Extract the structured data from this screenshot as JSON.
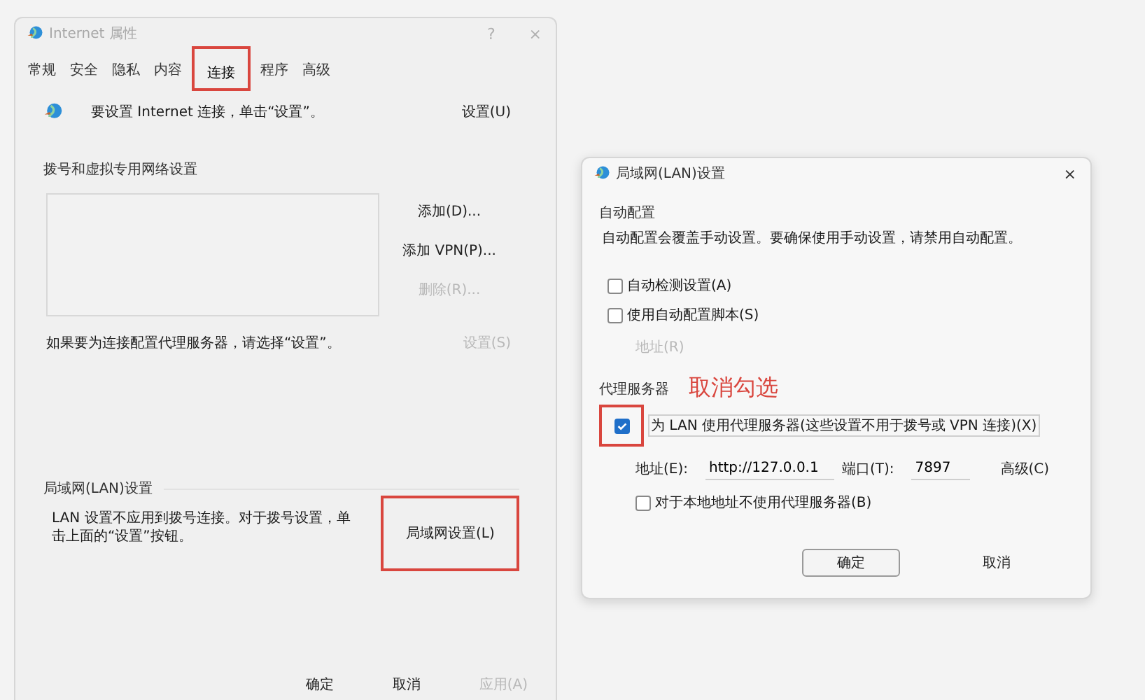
{
  "main_window": {
    "title": "Internet 属性",
    "help": "?",
    "close": "×",
    "tabs": [
      {
        "label": "常规",
        "selected": false,
        "highlighted": false
      },
      {
        "label": "安全",
        "selected": false,
        "highlighted": false
      },
      {
        "label": "隐私",
        "selected": false,
        "highlighted": false
      },
      {
        "label": "内容",
        "selected": false,
        "highlighted": false
      },
      {
        "label": "连接",
        "selected": true,
        "highlighted": true
      },
      {
        "label": "程序",
        "selected": false,
        "highlighted": false
      },
      {
        "label": "高级",
        "selected": false,
        "highlighted": false
      }
    ],
    "setup": {
      "text": "要设置 Internet 连接，单击“设置”。",
      "button": "设置(U)"
    },
    "dialup": {
      "heading": "拨号和虚拟专用网络设置",
      "buttons": [
        {
          "label": "添加(D)...",
          "disabled": false
        },
        {
          "label": "添加 VPN(P)...",
          "disabled": false
        },
        {
          "label": "删除(R)...",
          "disabled": true
        }
      ],
      "hint": "如果要为连接配置代理服务器，请选择“设置”。",
      "settings_button": {
        "label": "设置(S)",
        "disabled": true
      }
    },
    "lan": {
      "heading": "局域网(LAN)设置",
      "text": "LAN 设置不应用到拨号连接。对于拨号设置，单击上面的“设置”按钮。",
      "button": {
        "label": "局域网设置(L)",
        "highlighted": true
      }
    },
    "footer": [
      {
        "label": "确定",
        "disabled": false
      },
      {
        "label": "取消",
        "disabled": false
      },
      {
        "label": "应用(A)",
        "disabled": true
      }
    ]
  },
  "lan_dialog": {
    "title": "局域网(LAN)设置",
    "close": "×",
    "auto_config": {
      "heading": "自动配置",
      "text": "自动配置会覆盖手动设置。要确保使用手动设置，请禁用自动配置。",
      "checkboxes": [
        {
          "label": "自动检测设置(A)",
          "checked": false
        },
        {
          "label": "使用自动配置脚本(S)",
          "checked": false
        }
      ],
      "address_label": {
        "label": "地址(R)",
        "disabled": true
      }
    },
    "proxy": {
      "heading": "代理服务器",
      "use_proxy": {
        "label": "为 LAN 使用代理服务器(这些设置不用于拨号或 VPN 连接)(X)",
        "checked": true,
        "highlighted": true
      },
      "address": {
        "label": "地址(E):",
        "value": "http://127.0.0.1"
      },
      "port": {
        "label": "端口(T):",
        "value": "7897"
      },
      "advanced": "高级(C)",
      "bypass": {
        "label": "对于本地地址不使用代理服务器(B)",
        "checked": false
      }
    },
    "buttons": [
      {
        "label": "确定",
        "default": true
      },
      {
        "label": "取消",
        "default": false
      }
    ]
  },
  "annotation": {
    "text": "取消勾选"
  }
}
